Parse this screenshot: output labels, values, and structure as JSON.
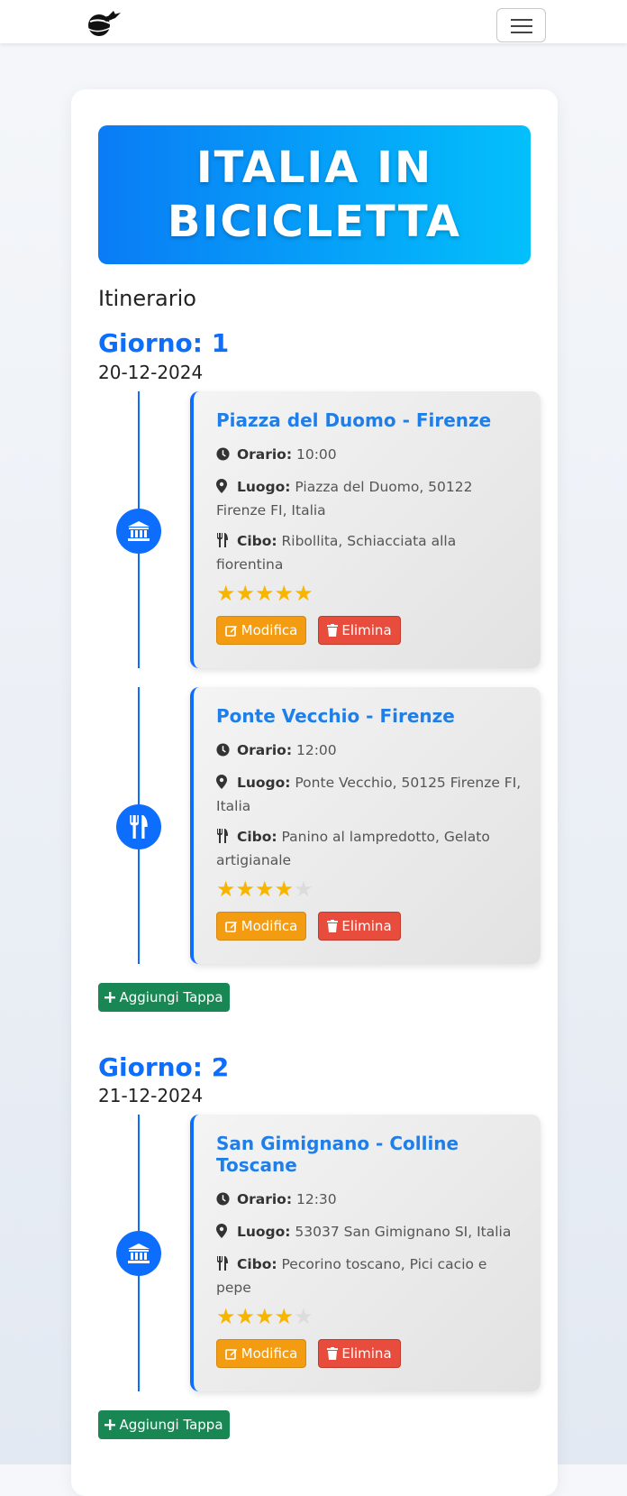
{
  "navbar": {
    "logo_icon": "plane-globe-logo",
    "menu_icon": "hamburger-icon"
  },
  "hero": {
    "title_line1": "ITALIA IN",
    "title_line2": "BICICLETTA"
  },
  "section_title": "Itinerario",
  "labels": {
    "orario": "Orario:",
    "luogo": "Luogo:",
    "cibo": "Cibo:",
    "edit": "Modifica",
    "delete": "Elimina",
    "add_stop": "Aggiungi Tappa"
  },
  "days": [
    {
      "title": "Giorno: 1",
      "date": "20-12-2024",
      "stops": [
        {
          "icon": "landmark-icon",
          "title": "Piazza del Duomo - Firenze",
          "orario": "10:00",
          "luogo": "Piazza del Duomo, 50122 Firenze FI, Italia",
          "cibo": "Ribollita, Schiacciata alla fiorentina",
          "rating": 5
        },
        {
          "icon": "utensils-icon",
          "title": "Ponte Vecchio - Firenze",
          "orario": "12:00",
          "luogo": "Ponte Vecchio, 50125 Firenze FI, Italia",
          "cibo": "Panino al lampredotto, Gelato artigianale",
          "rating": 4
        }
      ]
    },
    {
      "title": "Giorno: 2",
      "date": "21-12-2024",
      "stops": [
        {
          "icon": "landmark-icon",
          "title": "San Gimignano - Colline Toscane",
          "orario": "12:30",
          "luogo": "53037 San Gimignano SI, Italia",
          "cibo": "Pecorino toscano, Pici cacio e pepe",
          "rating": 4
        }
      ]
    }
  ],
  "colors": {
    "primary": "#0d6efd",
    "star": "#f7b500",
    "edit": "#f39c12",
    "delete": "#e74c3c",
    "add": "#198754"
  }
}
